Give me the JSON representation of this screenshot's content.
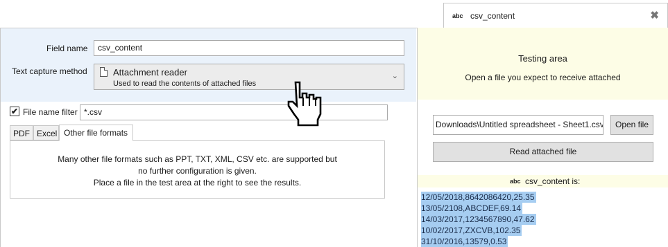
{
  "field_tab": {
    "type_icon": "abc",
    "name": "csv_content",
    "close_glyph": "✖"
  },
  "config": {
    "field_name_label": "Field name",
    "field_name_value": "csv_content",
    "method_label": "Text capture method",
    "method_title": "Attachment reader",
    "method_desc": "Used to read the contents of attached files",
    "chevron": "⌄",
    "filter_checked": "✔",
    "filter_label": "File name filter",
    "filter_value": "*.csv",
    "tabs": [
      "PDF",
      "Excel",
      "Other file formats"
    ],
    "panel_lines": [
      "Many other file formats such as PPT, TXT, XML, CSV etc. are supported but",
      "no further configuration is given.",
      "Place a file in the test area at the right to see the results."
    ]
  },
  "testing": {
    "title": "Testing area",
    "subtitle": "Open a file you expect to receive attached",
    "path": "Downloads\\Untitled spreadsheet - Sheet1.csv",
    "open_btn": "Open file",
    "read_btn": "Read attached file",
    "result_icon": "abc",
    "result_label": "csv_content is:",
    "result_lines": [
      "12/05/2018,8642086420,25.35",
      "13/05/2108,ABCDEF,69.14",
      "14/03/2017,1234567890,47.62",
      "10/02/2017,ZXCVB,102.35",
      "31/10/2016,13579,0.53"
    ]
  },
  "icons": {
    "doc": "document-icon",
    "hand": "hand-pointer-icon"
  }
}
